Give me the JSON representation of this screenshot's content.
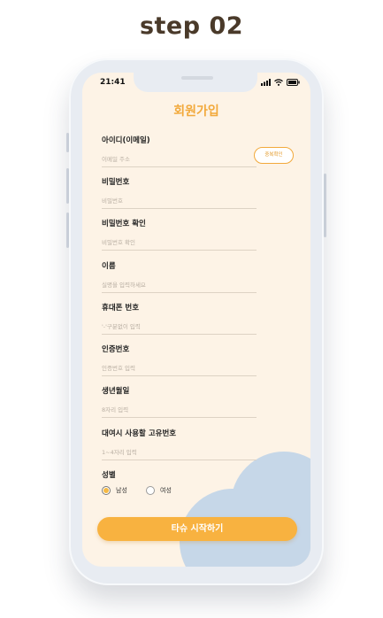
{
  "step": {
    "title": "step 02"
  },
  "status_bar": {
    "time": "21:41"
  },
  "page": {
    "title": "회원가입"
  },
  "fields": [
    {
      "label": "아이디(이메일)",
      "placeholder": "이메일 주소"
    },
    {
      "label": "비밀번호",
      "placeholder": "비밀번호"
    },
    {
      "label": "비밀번호 확인",
      "placeholder": "비밀번호 확인"
    },
    {
      "label": "이름",
      "placeholder": "실명을 입력하세요"
    },
    {
      "label": "휴대폰 번호",
      "placeholder": "'-'구분없이 입력"
    },
    {
      "label": "인증번호",
      "placeholder": "인증번호 입력"
    },
    {
      "label": "생년월일",
      "placeholder": "8자리 입력"
    },
    {
      "label": "대여시 사용할 고유번호",
      "placeholder": "1~4자리 입력"
    }
  ],
  "check_button": {
    "label": "중복확인"
  },
  "gender": {
    "label": "성별",
    "options": [
      "남성",
      "여성"
    ],
    "selected": "남성"
  },
  "start_button": {
    "label": "타슈 시작하기"
  },
  "colors": {
    "accent": "#f8b240",
    "title": "#f2a93b",
    "screen_bg": "#fdf3e6",
    "cloud": "#c6d7e8"
  }
}
